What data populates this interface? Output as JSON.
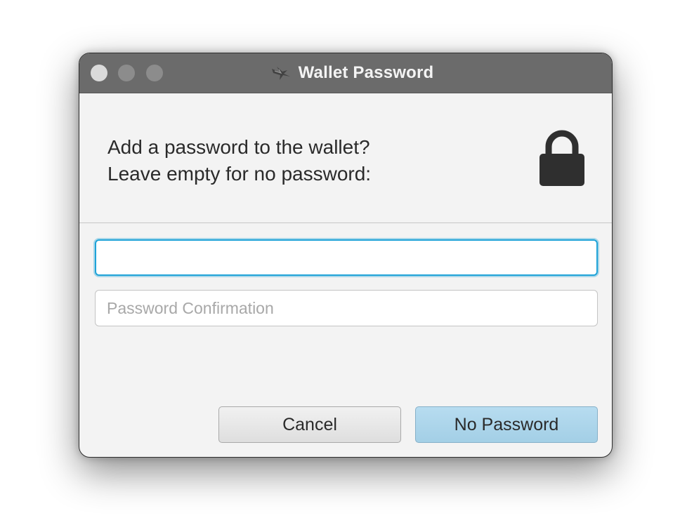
{
  "window": {
    "title": "Wallet Password",
    "app_icon": "sparrow-bird-icon",
    "controls": [
      "close",
      "minimize",
      "zoom"
    ]
  },
  "dialog": {
    "message_line1": "Add a password to the wallet?",
    "message_line2": "Leave empty for no password:",
    "header_icon": "lock-icon"
  },
  "fields": {
    "password": {
      "value": "",
      "placeholder": ""
    },
    "confirmation": {
      "value": "",
      "placeholder": "Password Confirmation"
    }
  },
  "buttons": {
    "cancel_label": "Cancel",
    "primary_label": "No Password"
  },
  "colors": {
    "titlebar": "#6b6b6b",
    "focus_ring": "#1fa3d8",
    "primary_button": "#a8d3ea",
    "lock": "#2f2f2f"
  }
}
